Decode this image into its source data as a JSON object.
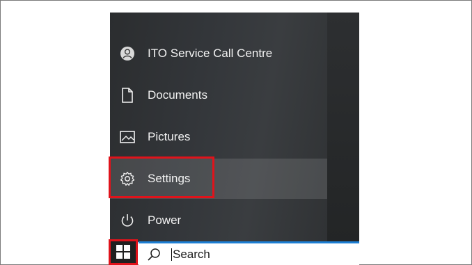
{
  "start_menu": {
    "items": [
      {
        "label": "ITO Service Call Centre",
        "icon": "user-avatar-icon"
      },
      {
        "label": "Documents",
        "icon": "document-icon"
      },
      {
        "label": "Pictures",
        "icon": "pictures-icon"
      },
      {
        "label": "Settings",
        "icon": "gear-icon"
      },
      {
        "label": "Power",
        "icon": "power-icon"
      }
    ]
  },
  "taskbar": {
    "start_icon": "windows-logo-icon",
    "search_icon": "search-icon",
    "search_label": "Search"
  },
  "colors": {
    "highlight": "#e0131b",
    "accent": "#1d7fd4",
    "menu_bg": "#33363a"
  }
}
